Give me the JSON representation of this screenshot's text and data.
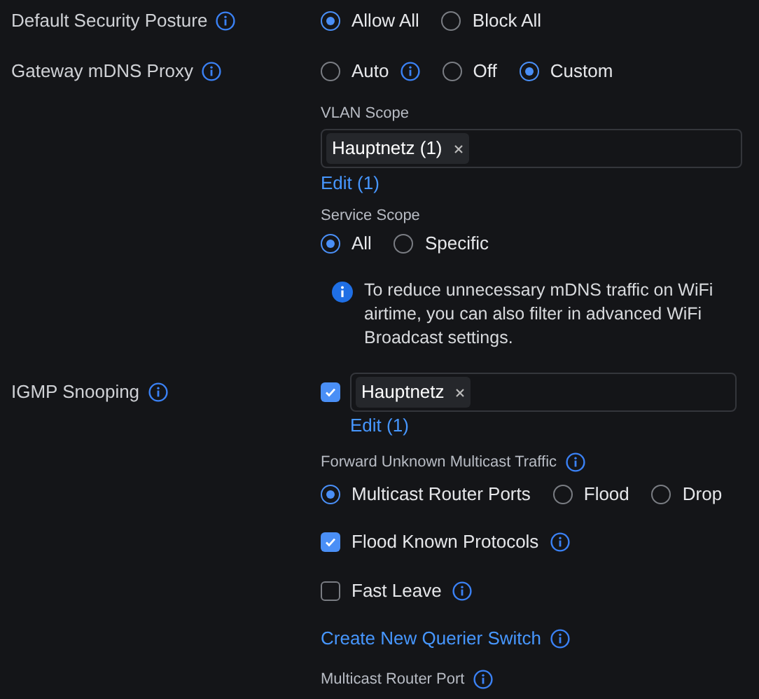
{
  "security_posture": {
    "label": "Default Security Posture",
    "options": [
      {
        "label": "Allow All",
        "selected": true,
        "info": false
      },
      {
        "label": "Block All",
        "selected": false,
        "info": false
      }
    ]
  },
  "mdns_proxy": {
    "label": "Gateway mDNS Proxy",
    "options": [
      {
        "label": "Auto",
        "selected": false,
        "info": true
      },
      {
        "label": "Off",
        "selected": false,
        "info": false
      },
      {
        "label": "Custom",
        "selected": true,
        "info": false
      }
    ],
    "vlan_scope": {
      "label": "VLAN Scope",
      "tags": [
        "Hauptnetz (1)"
      ],
      "link": "Edit (1)"
    },
    "service_scope": {
      "label": "Service Scope",
      "options": [
        {
          "label": "All",
          "selected": true,
          "info": false
        },
        {
          "label": "Specific",
          "selected": false,
          "info": false
        }
      ]
    },
    "note": "To reduce unnecessary mDNS traffic on WiFi airtime, you can also filter in advanced WiFi Broadcast settings."
  },
  "igmp": {
    "label": "IGMP Snooping",
    "checked": true,
    "tags": [
      "Hauptnetz"
    ],
    "link": "Edit (1)",
    "forward": {
      "label": "Forward Unknown Multicast Traffic",
      "options": [
        {
          "label": "Multicast Router Ports",
          "selected": true,
          "info": false
        },
        {
          "label": "Flood",
          "selected": false,
          "info": false
        },
        {
          "label": "Drop",
          "selected": false,
          "info": false
        }
      ]
    },
    "flood_known": {
      "label": "Flood Known Protocols",
      "checked": true
    },
    "fast_leave": {
      "label": "Fast Leave",
      "checked": false
    },
    "querier_link": "Create New Querier Switch",
    "router_port_label": "Multicast Router Port"
  }
}
